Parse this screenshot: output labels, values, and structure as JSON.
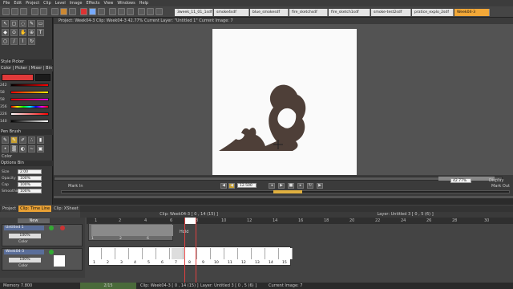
{
  "menubar": {
    "items": [
      "File",
      "Edit",
      "Project",
      "Clip",
      "Level",
      "Image",
      "Effects",
      "View",
      "Windows",
      "Help"
    ]
  },
  "file_tabs": [
    {
      "label": "Week04-3",
      "active": false
    },
    {
      "label": "3week_11_01_1sdf",
      "active": false
    },
    {
      "label": "smoke4sdf",
      "active": false
    },
    {
      "label": "blue_smokesdf",
      "active": false
    },
    {
      "label": "fire_sketchsdf",
      "active": false
    },
    {
      "label": "fire_sketch1sdf",
      "active": false
    },
    {
      "label": "smoke-test2sdf",
      "active": false
    },
    {
      "label": "pratice_explo_2sdf",
      "active": false
    },
    {
      "label": "Week04-3",
      "active": true
    }
  ],
  "left_panel": {
    "color_picker_title": "Style Picker",
    "tabs_label": "Color | Picker | Mixer | Bin",
    "rgb_values": [
      "242",
      "58",
      "58",
      "356",
      "226",
      "140"
    ],
    "tool_title": "Pen Brush",
    "color_label": "Color",
    "options_label": "Options  Bin",
    "size_label": "Size",
    "size_value": "2.00",
    "opacity_label": "Opacity",
    "opacity_value": "100%",
    "cap_label": "Cap",
    "smooth_label": "Smoothing",
    "cap_value": "100%",
    "mode_value": "100%",
    "stroke_color": "#e03a3a"
  },
  "viewer": {
    "header": "Project: Week04-3   Clip: Week04-3   42.77%   Current Layer: \"Untitled 1\"  Current Image: 7",
    "zoom": "42.77%",
    "mark_in": "Mark In",
    "mark_out": "Mark Out",
    "fps": "12.500",
    "display": "Display"
  },
  "xsheet": {
    "tabs": [
      {
        "label": "Project",
        "active": false
      },
      {
        "label": "Clip: Time Line",
        "active": true
      },
      {
        "label": "Clip: XSheet",
        "active": false
      }
    ],
    "clip_header": "Clip: Week04-3 [ 0 , 14 (15) ]",
    "layer_header": "Layer: Untitled 3 [ 0 , 5 (6) ]",
    "new_button": "New",
    "hold_label": "Hold",
    "ruler": [
      "1",
      "2",
      "4",
      "6",
      "8",
      "10",
      "12",
      "14",
      "16",
      "18",
      "20",
      "22",
      "24",
      "26",
      "28",
      "30"
    ],
    "layers": [
      {
        "name": "Untitled 1",
        "opacity": "100%",
        "color": "Color"
      },
      {
        "name": "Week04-3",
        "opacity": "100%",
        "color": "Color"
      }
    ],
    "track1_marks": [
      "1",
      "2",
      "4",
      "6"
    ],
    "track2_marks": [
      "1",
      "2",
      "3",
      "4",
      "5",
      "6",
      "7",
      "8",
      "9",
      "10",
      "11",
      "12",
      "13",
      "14",
      "15"
    ]
  },
  "status": {
    "left": "Memory 7.800",
    "frames": "2/15",
    "clip": "Clip: Week04-3 [ 0 , 14 (15) ]",
    "layer": "Layer: Untitled 3 [ 0 , 5 (6) ]",
    "image": "Current Image: 7"
  }
}
